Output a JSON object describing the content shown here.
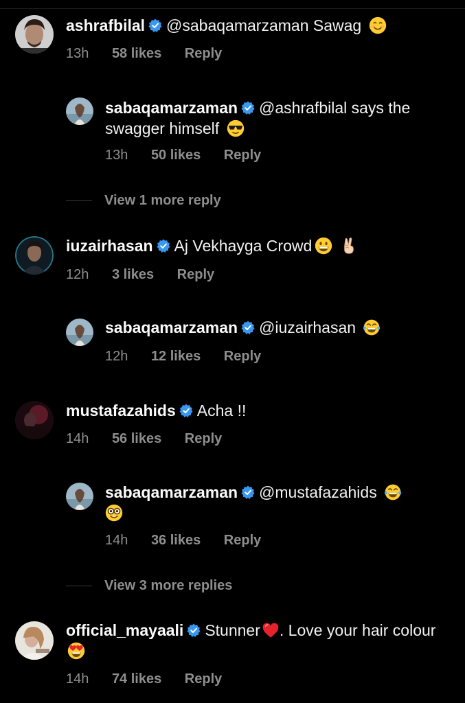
{
  "comments": [
    {
      "username": "ashrafbilal",
      "text": "@sabaqamarzaman Sawag",
      "emoji": "smiling-face-icon",
      "time": "13h",
      "likes": "58 likes",
      "reply": "Reply"
    },
    {
      "username": "sabaqamarzaman",
      "text": "@ashrafbilal says the swagger himself",
      "emoji": "sunglasses-face-icon",
      "time": "13h",
      "likes": "50 likes",
      "reply": "Reply"
    },
    {
      "view_more": "View 1 more reply"
    },
    {
      "username": "iuzairhasan",
      "text": "Aj Vekhayga Crowd",
      "emoji": "grinning-face-icon",
      "emoji2": "victory-hand-icon",
      "time": "12h",
      "likes": "3 likes",
      "reply": "Reply"
    },
    {
      "username": "sabaqamarzaman",
      "text": "@iuzairhasan",
      "emoji": "tears-of-joy-icon",
      "time": "12h",
      "likes": "12 likes",
      "reply": "Reply"
    },
    {
      "username": "mustafazahids",
      "text": "Acha !!",
      "time": "14h",
      "likes": "56 likes",
      "reply": "Reply"
    },
    {
      "username": "sabaqamarzaman",
      "text": "@mustafazahids",
      "emoji": "tears-of-joy-icon",
      "emoji2": "nerd-face-icon",
      "time": "14h",
      "likes": "36 likes",
      "reply": "Reply"
    },
    {
      "view_more": "View 3 more replies"
    },
    {
      "username": "official_mayaali",
      "text_a": "Stunner",
      "text_b": ". Love your hair colour",
      "emoji": "red-heart-icon",
      "emoji2": "heart-eyes-face-icon",
      "time": "14h",
      "likes": "74 likes",
      "reply": "Reply"
    }
  ],
  "colors": {
    "background": "#000000",
    "text": "#f2f2f2",
    "meta": "#8e8e8e",
    "verified": "#3897f0"
  }
}
